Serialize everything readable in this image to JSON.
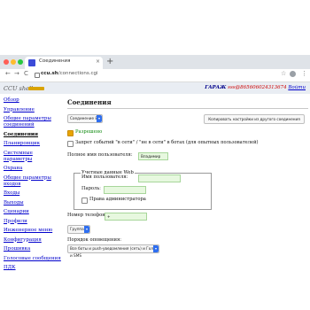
{
  "browser": {
    "tab_title": "Соединения",
    "tab_close": "×",
    "new_tab": "+",
    "address_host": "ccu.sh",
    "address_path": "/connections.cgi",
    "back": "←",
    "forward": "→",
    "reload": "C",
    "star": "☆",
    "menu": "⋮"
  },
  "header": {
    "logo": "CCU shell",
    "server": "ГАРАЖ",
    "account": "sss@865606024313674",
    "login": "Войти"
  },
  "sidebar": {
    "items": [
      {
        "label": "Обзор"
      },
      {
        "label": "Управление"
      },
      {
        "label": "Общие параметры соединений"
      },
      {
        "label": "Соединения"
      },
      {
        "label": "Планировщик"
      },
      {
        "label": "Системные параметры"
      },
      {
        "label": "Охрана"
      },
      {
        "label": "Общие параметры входов"
      },
      {
        "label": "Входы"
      },
      {
        "label": "Выходы"
      },
      {
        "label": "Сценарии"
      },
      {
        "label": "Профили"
      },
      {
        "label": "Инженерное меню"
      },
      {
        "label": "Конфигурация"
      },
      {
        "label": "Прошивка"
      },
      {
        "label": "Голосовые сообщения"
      },
      {
        "label": "ПДК"
      }
    ]
  },
  "main": {
    "title": "Соединения",
    "connection_select": "Соединение 8",
    "copy_button": "Копировать настройки из другого соединения",
    "enabled_label": "Разрешено",
    "ban_label": "Запрет событий \"в сети\" / \"не в сети\" в ботах (для опытных пользователей)",
    "full_name_label": "Полное имя пользователя:",
    "full_name_value": "Владимир",
    "web_legend": "Учетные данные Web",
    "username_label": "Имя пользователя:",
    "password_label": "Пароль:",
    "admin_label": "Права администратора",
    "phone_label": "Номер телефона:",
    "phone_value": "+",
    "group_select": "Группа 8",
    "order_label": "Порядок оповещения:",
    "order_select": "Все боты и push-уведомления (сеть) и Голос и SMS"
  },
  "colors": {
    "link": "#0000cc",
    "field_bg": "#e7f8df",
    "logo_bar": "#d9a300",
    "select_accent": "#2e6ef0"
  }
}
